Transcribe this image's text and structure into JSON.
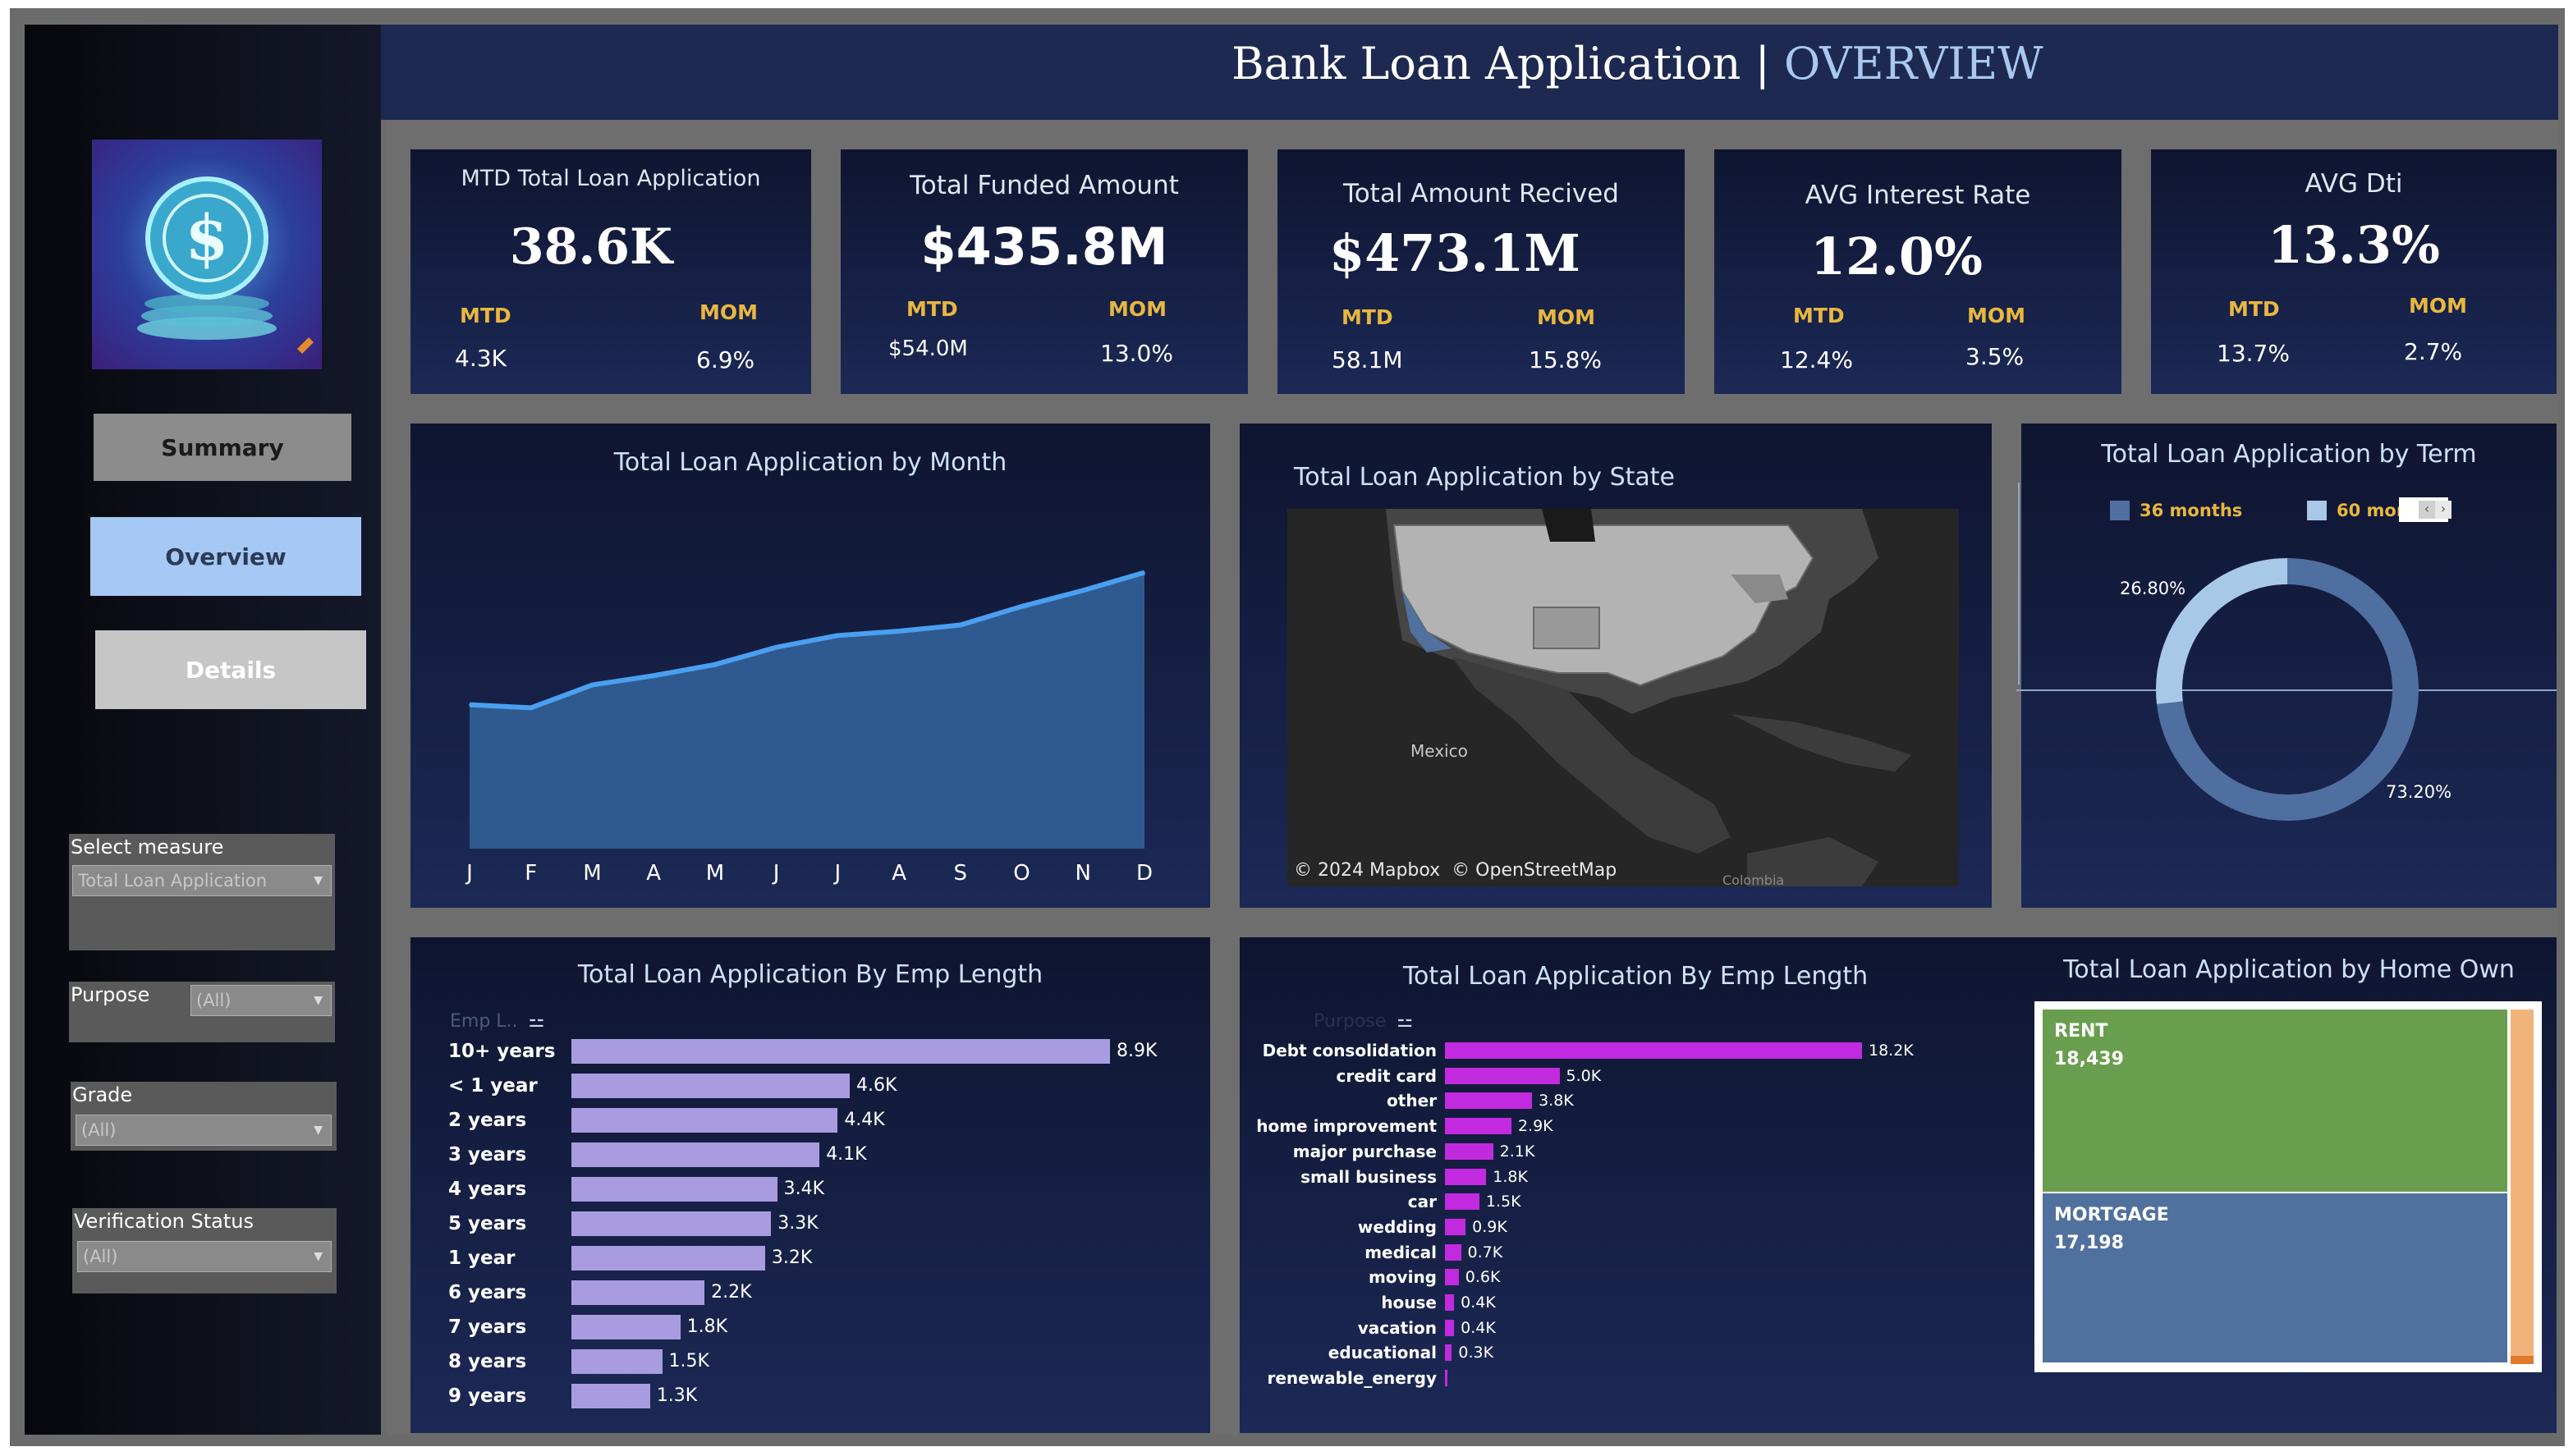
{
  "header": {
    "title_main": "Bank Loan Application | ",
    "title_accent": "OVERVIEW"
  },
  "nav": {
    "summary": "Summary",
    "overview": "Overview",
    "details": "Details"
  },
  "filters": {
    "select_measure": {
      "label": "Select measure",
      "value": "Total Loan Application"
    },
    "purpose": {
      "label": "Purpose",
      "value": "(All)"
    },
    "grade": {
      "label": "Grade",
      "value": "(All)"
    },
    "verification": {
      "label": "Verification Status",
      "value": "(All)"
    }
  },
  "kpis": [
    {
      "title": "MTD Total Loan Application",
      "value": "38.6K",
      "mtd_label": "MTD",
      "mtd": "4.3K",
      "mom_label": "MOM",
      "mom": "6.9%"
    },
    {
      "title": "Total Funded Amount",
      "value": "$435.8M",
      "mtd_label": "MTD",
      "mtd": "$54.0M",
      "mom_label": "MOM",
      "mom": "13.0%"
    },
    {
      "title": "Total Amount Recived",
      "value": "$473.1M",
      "mtd_label": "MTD",
      "mtd": "58.1M",
      "mom_label": "MOM",
      "mom": "15.8%"
    },
    {
      "title": "AVG Interest Rate",
      "value": "12.0%",
      "mtd_label": "MTD",
      "mtd": "12.4%",
      "mom_label": "MOM",
      "mom": "3.5%"
    },
    {
      "title": "AVG Dti",
      "value": "13.3%",
      "mtd_label": "MTD",
      "mtd": "13.7%",
      "mom_label": "MOM",
      "mom": "2.7%"
    }
  ],
  "map": {
    "title": "Total Loan Application by State",
    "label_mexico": "Mexico",
    "label_colombia": "Colombia",
    "attribution_mapbox": "© 2024 Mapbox",
    "attribution_osm": "© OpenStreetMap"
  },
  "donut_panel": {
    "title": "Total Loan Application by Term"
  },
  "treemap_panel": {
    "title": "Total Loan Application by Home Own"
  },
  "icons": {
    "logo": "dollar-coin-icon",
    "sort": "sort-icon",
    "caret": "chevron-down-icon"
  },
  "chart_data": [
    {
      "type": "area",
      "title": "Total Loan Application by Month",
      "categories": [
        "J",
        "F",
        "M",
        "A",
        "M",
        "J",
        "J",
        "A",
        "S",
        "O",
        "N",
        "D"
      ],
      "values": [
        2.33,
        2.28,
        2.65,
        2.8,
        2.98,
        3.26,
        3.45,
        3.52,
        3.62,
        3.92,
        4.18,
        4.47
      ],
      "ylim": [
        0,
        5.5
      ],
      "color": "#2f5a8f",
      "line_color": "#4a9ff0"
    },
    {
      "type": "bar",
      "orientation": "horizontal",
      "title": "Total Loan Application By Emp Length",
      "field_label": "Emp L..",
      "categories": [
        "10+ years",
        "< 1 year",
        "2 years",
        "3 years",
        "4 years",
        "5 years",
        "1 year",
        "6 years",
        "7 years",
        "8 years",
        "9 years"
      ],
      "values": [
        8.9,
        4.6,
        4.4,
        4.1,
        3.4,
        3.3,
        3.2,
        2.2,
        1.8,
        1.5,
        1.3
      ],
      "labels": [
        "8.9K",
        "4.6K",
        "4.4K",
        "4.1K",
        "3.4K",
        "3.3K",
        "3.2K",
        "2.2K",
        "1.8K",
        "1.5K",
        "1.3K"
      ],
      "color": "#a99be0"
    },
    {
      "type": "bar",
      "orientation": "horizontal",
      "title": "Total Loan Application By Emp Length",
      "field_label": "Purpose",
      "categories": [
        "Debt consolidation",
        "credit card",
        "other",
        "home improvement",
        "major purchase",
        "small business",
        "car",
        "wedding",
        "medical",
        "moving",
        "house",
        "vacation",
        "educational",
        "renewable_energy"
      ],
      "values": [
        18.2,
        5.0,
        3.8,
        2.9,
        2.1,
        1.8,
        1.5,
        0.9,
        0.7,
        0.6,
        0.4,
        0.4,
        0.3,
        0.1
      ],
      "labels": [
        "18.2K",
        "5.0K",
        "3.8K",
        "2.9K",
        "2.1K",
        "1.8K",
        "1.5K",
        "0.9K",
        "0.7K",
        "0.6K",
        "0.4K",
        "0.4K",
        "0.3K",
        ""
      ],
      "color": "#c22ae0"
    },
    {
      "type": "pie",
      "donut": true,
      "title": "Total Loan Application by Term",
      "legend": [
        "36 months",
        "60 month"
      ],
      "values": [
        73.2,
        26.8
      ],
      "labels": [
        "73.20%",
        "26.80%"
      ],
      "colors": [
        "#4f6fa0",
        "#a8c8e8"
      ]
    },
    {
      "type": "treemap",
      "title": "Total Loan Application by Home Own",
      "categories": [
        "RENT",
        "MORTGAGE"
      ],
      "values": [
        18439,
        17198
      ],
      "labels": [
        "18,439",
        "17,198"
      ],
      "colors": [
        "#6a9e4f",
        "#50719e"
      ],
      "other_color": "#f0b47a"
    }
  ]
}
